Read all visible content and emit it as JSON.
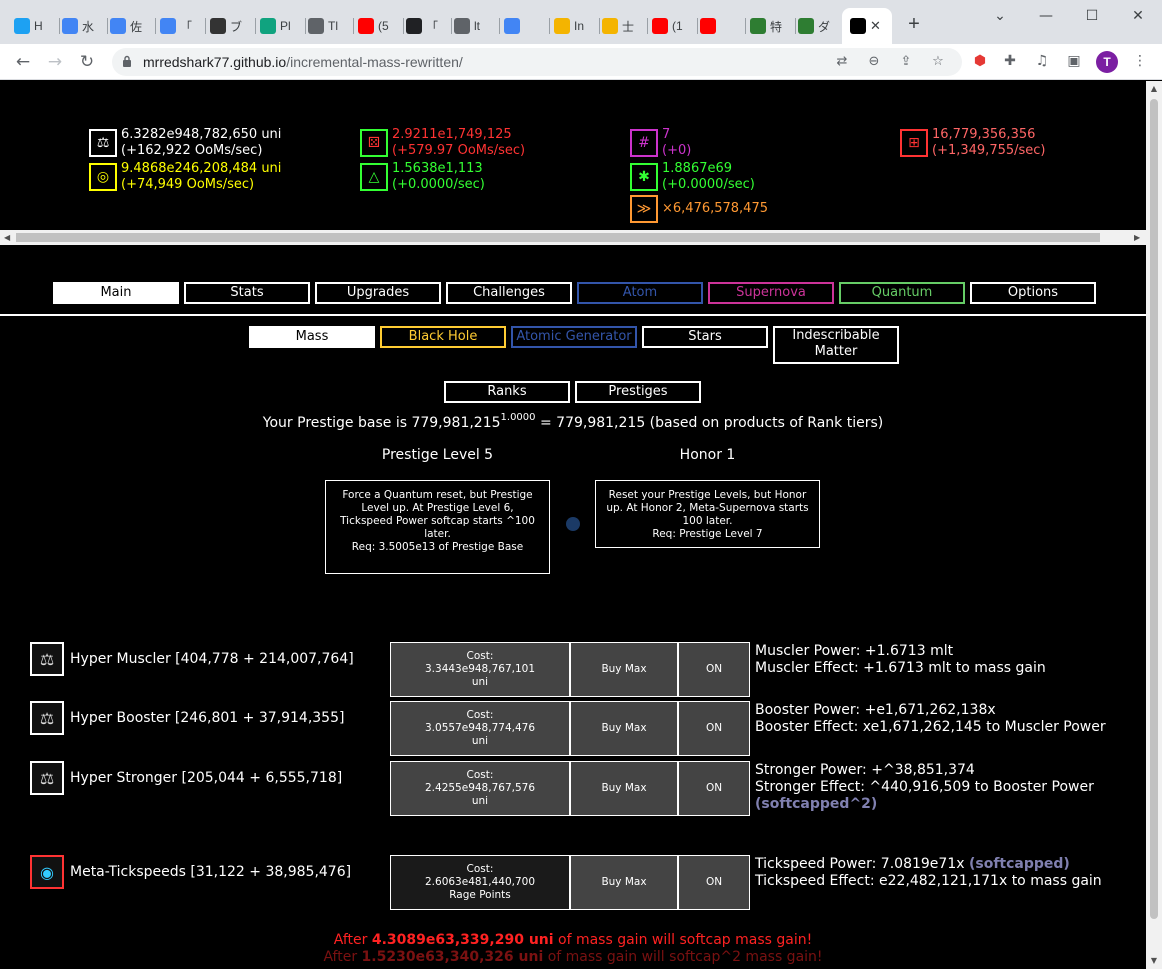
{
  "browser": {
    "tabs": [
      {
        "label": "H",
        "color": "#1da1f2"
      },
      {
        "label": "水",
        "color": "#4285f4"
      },
      {
        "label": "佐",
        "color": "#4285f4"
      },
      {
        "label": "「",
        "color": "#4285f4"
      },
      {
        "label": "ブ",
        "color": "#333333"
      },
      {
        "label": "Pl",
        "color": "#10a37f"
      },
      {
        "label": "Tl",
        "color": "#5f6368"
      },
      {
        "label": "(5",
        "color": "#ff0000"
      },
      {
        "label": "「",
        "color": "#202124"
      },
      {
        "label": "lt",
        "color": "#5f6368"
      },
      {
        "label": "",
        "color": "#4285f4"
      },
      {
        "label": "In",
        "color": "#f4b400"
      },
      {
        "label": "士",
        "color": "#f4b400"
      },
      {
        "label": "(1",
        "color": "#ff0000"
      },
      {
        "label": "",
        "color": "#ff0000"
      },
      {
        "label": "特",
        "color": "#2e7d32"
      },
      {
        "label": "ダ",
        "color": "#2e7d32"
      }
    ],
    "active_tab_close": "✕",
    "new_tab": "+",
    "url_host": "mrredshark77.github.io",
    "url_path": "/incremental-mass-rewritten/",
    "profile_initial": "T",
    "minimize": "—",
    "maximize": "☐",
    "close": "✕",
    "chevron": "⌄"
  },
  "resources": {
    "mass": {
      "value": "6.3282e948,782,650 uni",
      "rate": "(+162,922 OoMs/sec)",
      "color": "#ffffff"
    },
    "black_hole": {
      "value": "9.4868e246,208,484 uni",
      "rate": "(+74,949 OoMs/sec)",
      "color": "#ffff00"
    },
    "rage": {
      "value": "2.9211e1,749,125",
      "rate": "(+579.97 OoMs/sec)",
      "color": "#ff3333"
    },
    "dark_matter": {
      "value": "1.5638e1,113",
      "rate": "(+0.0000/sec)",
      "color": "#33ff33"
    },
    "ranks": {
      "value": "7",
      "rate": "(+0)",
      "color": "#cc33cc"
    },
    "stars": {
      "value": "1.8867e69",
      "rate": "(+0.0000/sec)",
      "color": "#33ff33"
    },
    "tickspeed": {
      "value": "×6,476,578,475",
      "color": "#ff9933"
    },
    "quantum": {
      "value": "16,779,356,356",
      "rate": "(+1,349,755/sec)",
      "color": "#ff6666"
    }
  },
  "main_tabs": [
    {
      "label": "Main",
      "color": "#ffffff"
    },
    {
      "label": "Stats",
      "color": "#ffffff"
    },
    {
      "label": "Upgrades",
      "color": "#ffffff"
    },
    {
      "label": "Challenges",
      "color": "#ffffff"
    },
    {
      "label": "Atom",
      "color": "#3355aa"
    },
    {
      "label": "Supernova",
      "color": "#cc3399"
    },
    {
      "label": "Quantum",
      "color": "#66cc66"
    },
    {
      "label": "Options",
      "color": "#ffffff"
    }
  ],
  "sub_tabs": [
    {
      "label": "Mass",
      "color": "#ffffff"
    },
    {
      "label": "Black Hole",
      "color": "#ffcc33"
    },
    {
      "label": "Atomic Generator",
      "color": "#3355aa"
    },
    {
      "label": "Stars",
      "color": "#ffffff"
    },
    {
      "label": "Indescribable Matter",
      "color": "#ffffff"
    }
  ],
  "rank_tabs": [
    "Ranks",
    "Prestiges"
  ],
  "prestige": {
    "base_pre": "Your Prestige base is 779,981,215",
    "base_exp": "1.0000",
    "base_post": " = 779,981,215 (based on products of Rank tiers)",
    "level_title": "Prestige Level 5",
    "honor_title": "Honor 1",
    "level_desc": "Force a Quantum reset, but Prestige Level up. At Prestige Level 6, Tickspeed Power softcap starts ^100 later.",
    "level_req": "Req: 3.5005e13 of Prestige Base",
    "honor_desc": "Reset your Prestige Levels, but Honor up. At Honor 2, Meta-Supernova starts 100 later.",
    "honor_req": "Req: Prestige Level 7"
  },
  "upgrades": [
    {
      "name": "Hyper Muscler [404,778 + 214,007,764]",
      "cost_label": "Cost:",
      "cost": "3.3443e948,767,101",
      "unit": "uni",
      "buy": "Buy Max",
      "auto": "ON",
      "effect1": "Muscler Power: +1.6713 mlt",
      "effect2": "Muscler Effect: +1.6713 mlt to mass gain",
      "soft": ""
    },
    {
      "name": "Hyper Booster [246,801 + 37,914,355]",
      "cost_label": "Cost:",
      "cost": "3.0557e948,774,476",
      "unit": "uni",
      "buy": "Buy Max",
      "auto": "ON",
      "effect1": "Booster Power: +e1,671,262,138x",
      "effect2": "Booster Effect: xe1,671,262,145 to Muscler Power",
      "soft": ""
    },
    {
      "name": "Hyper Stronger [205,044 + 6,555,718]",
      "cost_label": "Cost:",
      "cost": "2.4255e948,767,576",
      "unit": "uni",
      "buy": "Buy Max",
      "auto": "ON",
      "effect1": "Stronger Power: +^38,851,374",
      "effect2": "Stronger Effect: ^440,916,509 to Booster Power",
      "soft": "(softcapped^2)"
    },
    {
      "name": "Meta-Tickspeeds [31,122 + 38,985,476]",
      "cost_label": "Cost:",
      "cost": "2.6063e481,440,700",
      "unit": "Rage Points",
      "buy": "Buy Max",
      "auto": "ON",
      "effect1": "Tickspeed Power: 7.0819e71x",
      "effect2": "Tickspeed Effect: e22,482,121,171x to mass gain",
      "soft": "(softcapped)"
    }
  ],
  "warnings": {
    "w1_pre": "After ",
    "w1_val": "4.3089e63,339,290 uni",
    "w1_post": " of mass gain will softcap mass gain!",
    "w2_pre": "After ",
    "w2_val": "1.5230e63,340,326 uni",
    "w2_post": " of mass gain will softcap^2 mass gain!"
  }
}
